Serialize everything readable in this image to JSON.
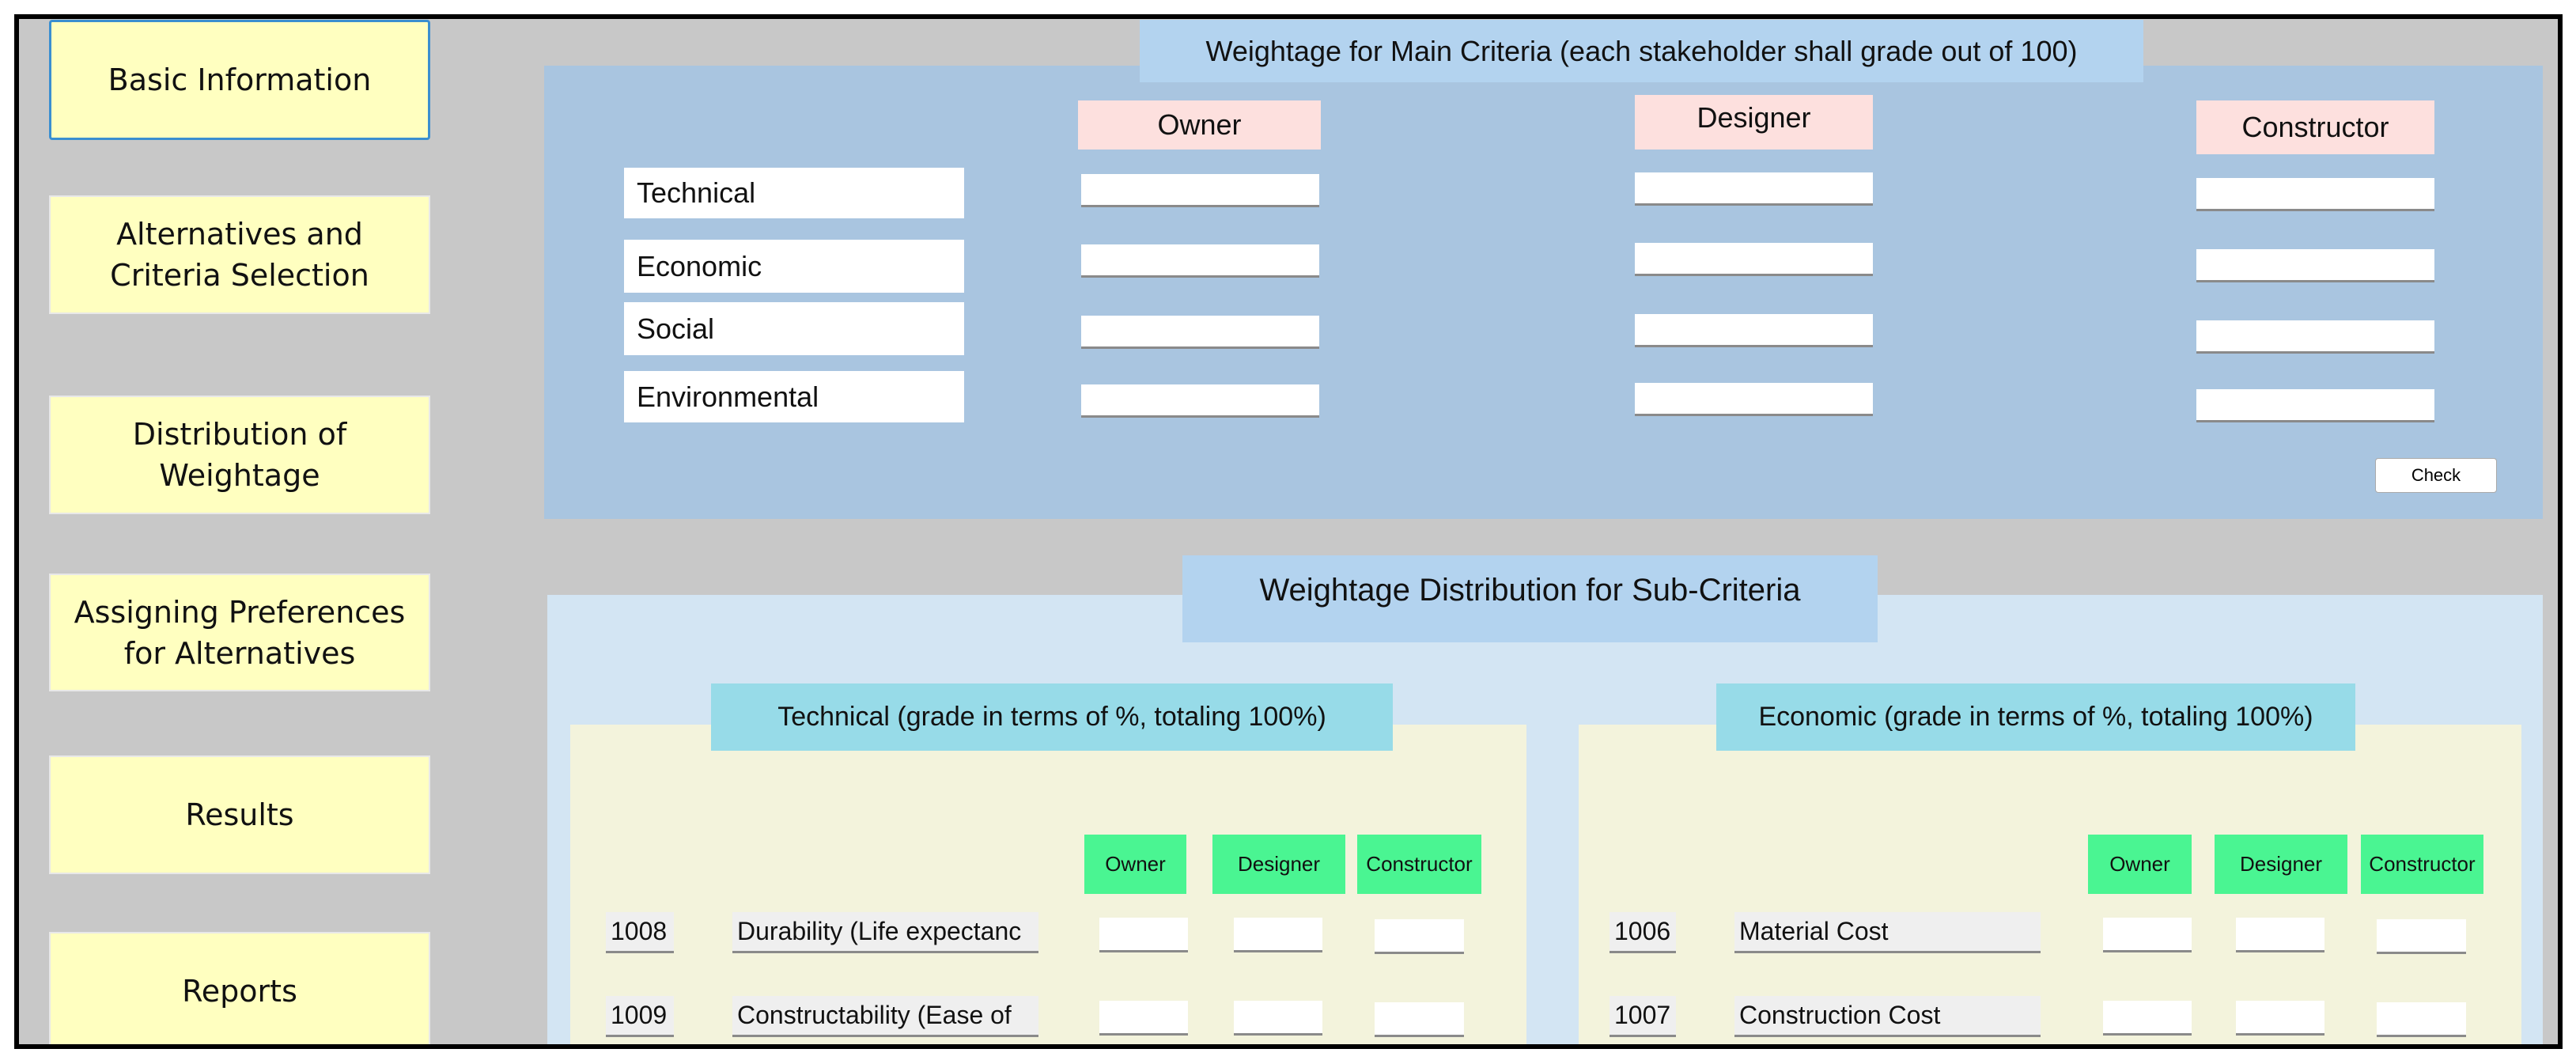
{
  "sidebar": {
    "items": [
      {
        "label": "Basic Information"
      },
      {
        "label": "Alternatives and Criteria Selection"
      },
      {
        "label": "Distribution of Weightage"
      },
      {
        "label": "Assigning Preferences for Alternatives"
      },
      {
        "label": "Results"
      },
      {
        "label": "Reports"
      }
    ]
  },
  "main_criteria": {
    "title": "Weightage for Main Criteria (each stakeholder shall grade out of 100)",
    "stakeholders": [
      "Owner",
      "Designer",
      "Constructor"
    ],
    "criteria": [
      "Technical",
      "Economic",
      "Social",
      "Environmental"
    ],
    "check_label": "Check"
  },
  "sub_criteria": {
    "title": "Weightage Distribution for Sub-Criteria",
    "groups": [
      {
        "title": "Technical (grade in terms of %, totaling 100%)",
        "headers": [
          "Owner",
          "Designer",
          "Constructor"
        ],
        "rows": [
          {
            "id": "1008",
            "name": "Durability (Life expectanc"
          },
          {
            "id": "1009",
            "name": "Constructability (Ease of"
          }
        ]
      },
      {
        "title": "Economic (grade in terms of %, totaling 100%)",
        "headers": [
          "Owner",
          "Designer",
          "Constructor"
        ],
        "rows": [
          {
            "id": "1006",
            "name": "Material Cost"
          },
          {
            "id": "1007",
            "name": "Construction Cost"
          }
        ]
      }
    ]
  }
}
